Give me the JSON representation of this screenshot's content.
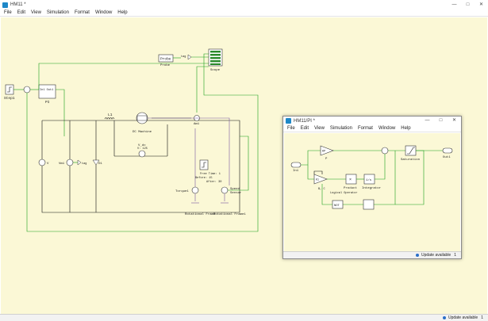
{
  "main_window": {
    "title": "HM11 *",
    "menu": [
      "File",
      "Edit",
      "View",
      "Simulation",
      "Format",
      "Window",
      "Help"
    ],
    "status": "Update available",
    "status_count": "1"
  },
  "sub_window": {
    "title": "HM11/PI *",
    "menu": [
      "File",
      "Edit",
      "View",
      "Simulation",
      "Format",
      "Window",
      "Help"
    ],
    "status": "Update available",
    "status_count": "1"
  },
  "diagram": {
    "step_label": "Step1",
    "pi_inner": "In1  Out1",
    "pi_label": "PI",
    "probe_label": "Probe",
    "probe_caption": "Probe",
    "scope_label": "Scope",
    "l1_label": "L1",
    "dc_machine_label": "DC Machine",
    "am1_label": "Am1",
    "vdc_label": "V_dc",
    "vdc_value": "V: 125",
    "v_label": "V",
    "vm1_label": "Vm1",
    "tag_label": "tag",
    "d1_label": "D1",
    "free_time_label": "Free Time: 1",
    "before_label": "Before: 15",
    "after_label": "After: 30",
    "torque_label": "Torque1",
    "speed_label": "Speed",
    "sensor_label": "Sensor",
    "rot_frame1_label": "Rotational Frame",
    "rot_frame2_label": "Rotational Frame1"
  },
  "sub_diagram": {
    "in_label": "In1",
    "out_label": "Out1",
    "p_label": "P",
    "p_gain": "KP",
    "ki_label": "Ki",
    "product_label": "Product",
    "integrator_label": "Integrator",
    "integrator_value": "1/s",
    "saturation_label": "Saturation",
    "logical_op_label": "Logical Operator",
    "not_label": "NOT",
    "bc_label": "B, C"
  }
}
